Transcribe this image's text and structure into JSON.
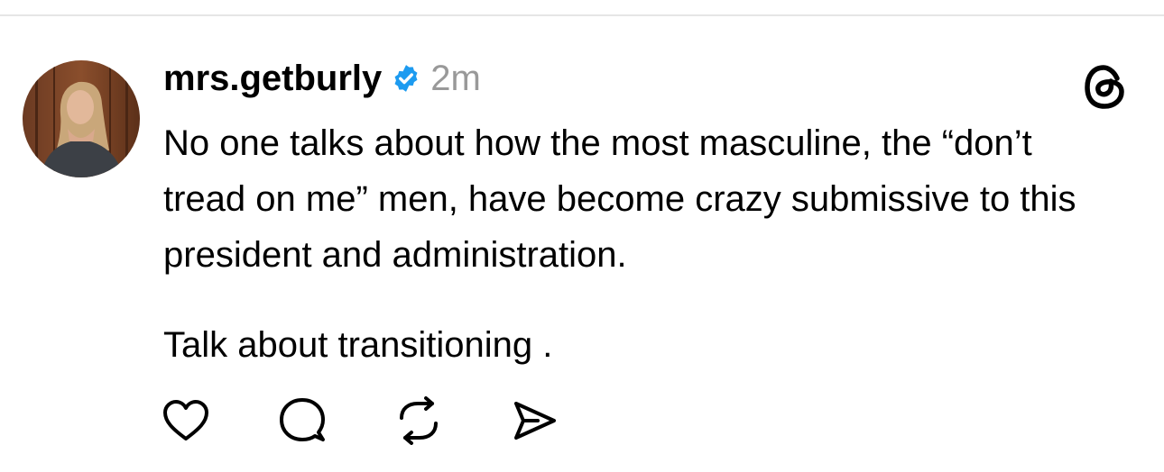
{
  "post": {
    "username": "mrs.getburly",
    "timestamp": "2m",
    "verified": true,
    "text_paragraphs": [
      "No one talks about how the most masculine, the “don’t tread on me” men, have become crazy submissive to this president and administration.",
      "Talk about transitioning ."
    ]
  },
  "icons": {
    "verified": "verified-badge-icon",
    "logo": "threads-logo-icon",
    "actions": [
      "heart-icon",
      "comment-icon",
      "repost-icon",
      "share-icon"
    ]
  },
  "colors": {
    "verified_blue": "#1d9bf0",
    "timestamp_gray": "#999999",
    "divider": "#e6e6e6"
  }
}
